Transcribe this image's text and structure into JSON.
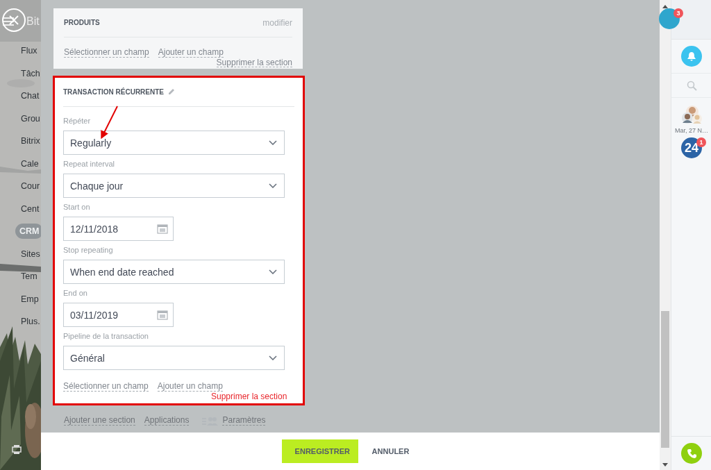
{
  "background_menu": {
    "logo": "Bit",
    "items": [
      {
        "label": "Flux",
        "selected": false
      },
      {
        "label": "Tâch",
        "selected": false
      },
      {
        "label": "Chat",
        "selected": false
      },
      {
        "label": "Grou",
        "selected": false
      },
      {
        "label": "Bitrix",
        "selected": false
      },
      {
        "label": "Cale",
        "selected": false
      },
      {
        "label": "Cour",
        "selected": false
      },
      {
        "label": "Cent",
        "selected": false
      },
      {
        "label": "CRM",
        "selected": true
      },
      {
        "label": "Sites",
        "selected": false
      },
      {
        "label": "Tem",
        "selected": false
      },
      {
        "label": "Emp",
        "selected": false
      },
      {
        "label": "Plus.",
        "selected": false
      }
    ]
  },
  "sections": [
    {
      "title": "PRODUITS",
      "edit": {
        "kind": "link",
        "label": "modifier"
      },
      "highlighted": false,
      "links": [
        "Sélectionner un champ",
        "Ajouter un champ"
      ],
      "delete_link": "Supprimer la section"
    },
    {
      "title": "TRANSACTION RÉCURRENTE",
      "edit": {
        "kind": "pencil"
      },
      "highlighted": true,
      "fields": [
        {
          "label": "Répéter",
          "kind": "select",
          "value": "Regularly"
        },
        {
          "label": "Repeat interval",
          "kind": "select",
          "value": "Chaque jour"
        },
        {
          "label": "Start on",
          "kind": "date",
          "value": "12/11/2018"
        },
        {
          "label": "Stop repeating",
          "kind": "select",
          "value": "When end date reached"
        },
        {
          "label": "End on",
          "kind": "date",
          "value": "03/11/2019"
        },
        {
          "label": "Pipeline de la transaction",
          "kind": "select",
          "value": "Général"
        }
      ],
      "links": [
        "Sélectionner un champ",
        "Ajouter un champ"
      ],
      "delete_link": "Supprimer la section"
    }
  ],
  "form_links": [
    "Ajouter une section",
    "Applications"
  ],
  "settings_link": "Paramètres",
  "footer": {
    "buttons": [
      {
        "label": "ENREGISTRER",
        "kind": "primary"
      },
      {
        "label": "ANNULER",
        "kind": "plain"
      }
    ]
  },
  "right_bar": {
    "top_badge": "3",
    "date": "Mar, 27 N…",
    "app_label": "24",
    "app_badge": "1"
  }
}
